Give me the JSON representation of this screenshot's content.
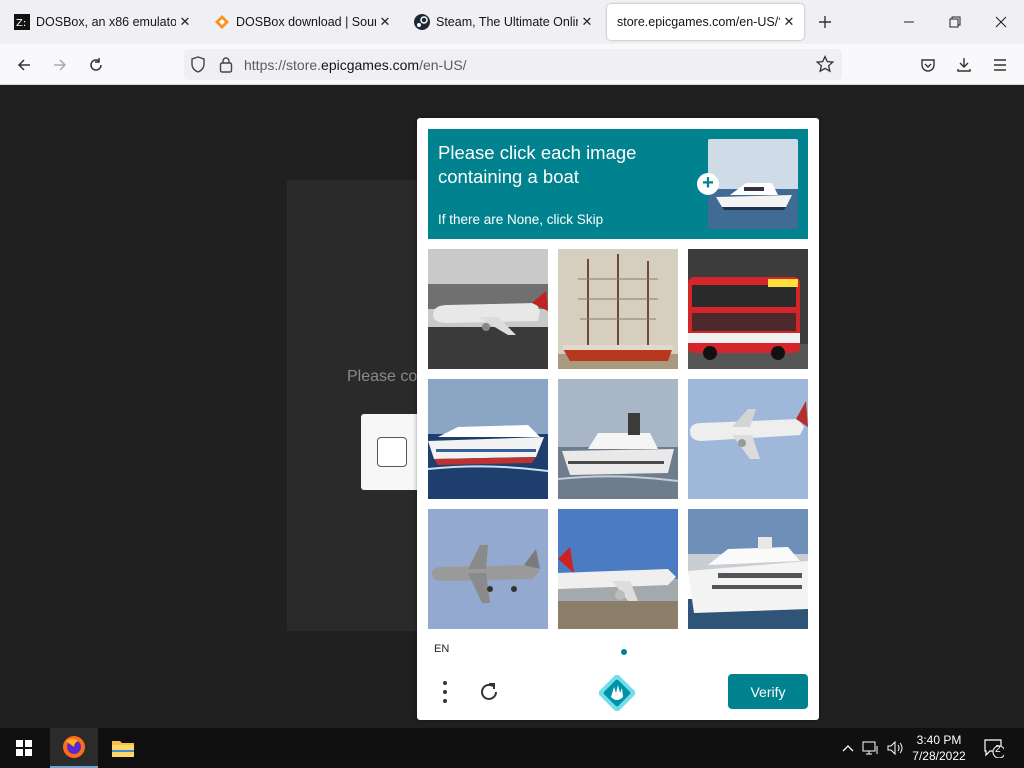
{
  "browser": {
    "tabs": [
      {
        "title": "DOSBox, an x86 emulator w",
        "favicon": "dosbox-icon"
      },
      {
        "title": "DOSBox download | Source",
        "favicon": "sourceforge-icon"
      },
      {
        "title": "Steam, The Ultimate Online",
        "favicon": "steam-icon"
      },
      {
        "title": "store.epicgames.com/en-US/?",
        "favicon": "none",
        "active": true
      }
    ],
    "url_prefix": "https://store.",
    "url_host": "epicgames.com",
    "url_suffix": "/en-US/"
  },
  "page": {
    "background_text": "Please co"
  },
  "captcha": {
    "prompt": "Please click each image containing a boat",
    "prompt_sub": "If there are None, click Skip",
    "tiles": [
      {
        "subject": "airplane"
      },
      {
        "subject": "sailing-ship"
      },
      {
        "subject": "bus"
      },
      {
        "subject": "cruise-ship"
      },
      {
        "subject": "ship"
      },
      {
        "subject": "airplane"
      },
      {
        "subject": "airplane"
      },
      {
        "subject": "airplane"
      },
      {
        "subject": "yacht"
      }
    ],
    "language": "EN",
    "verify_label": "Verify",
    "accent_color": "#00838f"
  },
  "taskbar": {
    "time": "3:40 PM",
    "date": "7/28/2022",
    "notifications": "2"
  }
}
